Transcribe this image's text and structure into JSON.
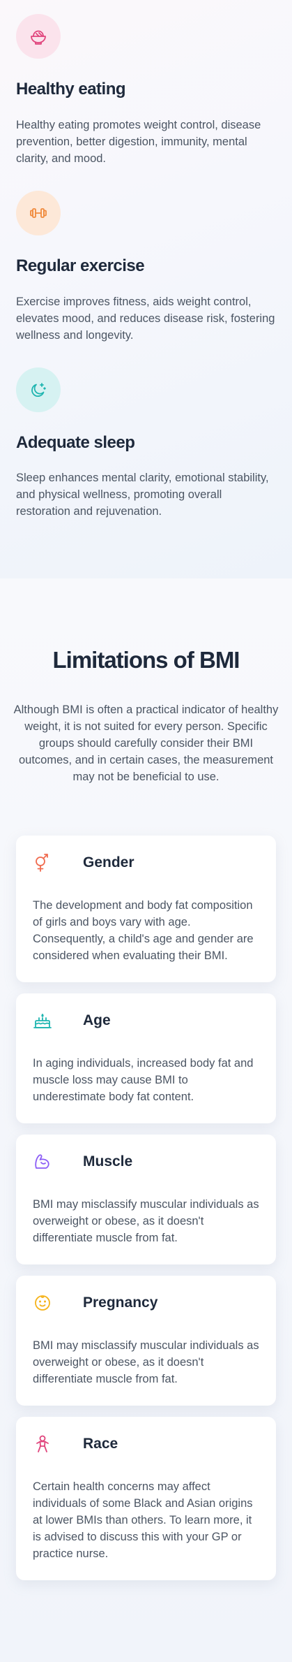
{
  "habits": [
    {
      "icon": "salad-bowl-icon",
      "color": "#e0447c",
      "bg": "#fbe3ec",
      "title": "Healthy eating",
      "description": "Healthy eating promotes weight control, disease prevention, better digestion, immunity, mental clarity, and mood."
    },
    {
      "icon": "dumbbell-icon",
      "color": "#f08a3c",
      "bg": "#fde8d8",
      "title": "Regular exercise",
      "description": "Exercise improves fitness, aids weight control, elevates mood, and reduces disease risk, fostering wellness and longevity."
    },
    {
      "icon": "moon-stars-icon",
      "color": "#1fb5b0",
      "bg": "#d6f2f2",
      "title": "Adequate sleep",
      "description": "Sleep enhances mental clarity, emotional stability, and physical wellness, promoting overall restoration and rejuvenation."
    }
  ],
  "limitations": {
    "title": "Limitations of BMI",
    "intro": "Although BMI is often a practical indicator of healthy weight, it is not suited for every person. Specific groups should carefully consider their BMI outcomes, and in certain cases, the measurement may not be beneficial to use.",
    "cards": [
      {
        "icon": "gender-icon",
        "color": "#f06b4f",
        "title": "Gender",
        "text": "The development and body fat composition of girls and boys vary with age. Consequently, a child's age and gender are considered when evaluating their BMI."
      },
      {
        "icon": "birthday-cake-icon",
        "color": "#1fb5b0",
        "title": "Age",
        "text": "In aging individuals, increased body fat and muscle loss may cause BMI to underestimate body fat content."
      },
      {
        "icon": "flexed-arm-icon",
        "color": "#8b5cf6",
        "title": "Muscle",
        "text": "BMI may misclassify muscular individuals as overweight or obese, as it doesn't differentiate muscle from fat."
      },
      {
        "icon": "pregnancy-icon",
        "color": "#f5b31b",
        "title": "Pregnancy",
        "text": "BMI may misclassify muscular individuals as overweight or obese, as it doesn't differentiate muscle from fat."
      },
      {
        "icon": "person-icon",
        "color": "#e0447c",
        "title": "Race",
        "text": "Certain health concerns may affect individuals of some Black and Asian origins at lower BMIs than others. To learn more, it is advised to discuss this with your GP or practice nurse."
      }
    ]
  }
}
